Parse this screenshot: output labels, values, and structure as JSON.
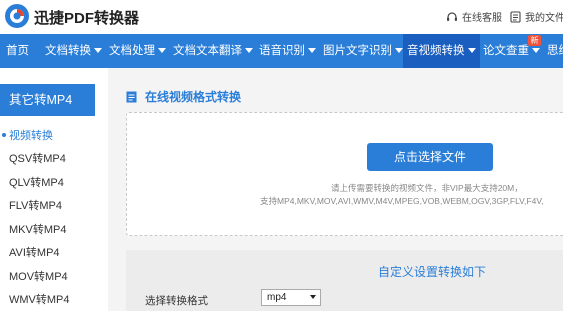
{
  "header": {
    "brand": "迅捷PDF转换器",
    "service_label": "在线客服",
    "my_files_label": "我的文件"
  },
  "nav": {
    "items": [
      {
        "label": "首页",
        "has_caret": false
      },
      {
        "label": "文档转换",
        "has_caret": true
      },
      {
        "label": "文档处理",
        "has_caret": true
      },
      {
        "label": "文档文本翻译",
        "has_caret": true
      },
      {
        "label": "语音识别",
        "has_caret": true
      },
      {
        "label": "图片文字识别",
        "has_caret": true
      },
      {
        "label": "音视频转换",
        "has_caret": true,
        "active": true
      },
      {
        "label": "论文查重",
        "has_caret": true
      },
      {
        "label": "思维",
        "has_caret": false
      }
    ],
    "new_badge": "新"
  },
  "sidebar": {
    "title": "其它转MP4",
    "items": [
      {
        "label": "视频转换",
        "active": true
      },
      {
        "label": "QSV转MP4"
      },
      {
        "label": "QLV转MP4"
      },
      {
        "label": "FLV转MP4"
      },
      {
        "label": "MKV转MP4"
      },
      {
        "label": "AVI转MP4"
      },
      {
        "label": "MOV转MP4"
      },
      {
        "label": "WMV转MP4"
      }
    ]
  },
  "main": {
    "section_title": "在线视频格式转换",
    "upload_button": "点击选择文件",
    "hint_line1": "请上传需要转换的视频文件，非VIP最大支持20M，",
    "hint_line2": "支持MP4,MKV,MOV,AVI,WMV,M4V,MPEG,VOB,WEBM,OGV,3GP,FLV,F4V,",
    "settings_title": "自定义设置转换如下",
    "format_label": "选择转换格式",
    "format_value": "mp4"
  },
  "colors": {
    "accent": "#2a7ed8",
    "nav_active": "#1a5ec0",
    "badge": "#f0533a"
  }
}
